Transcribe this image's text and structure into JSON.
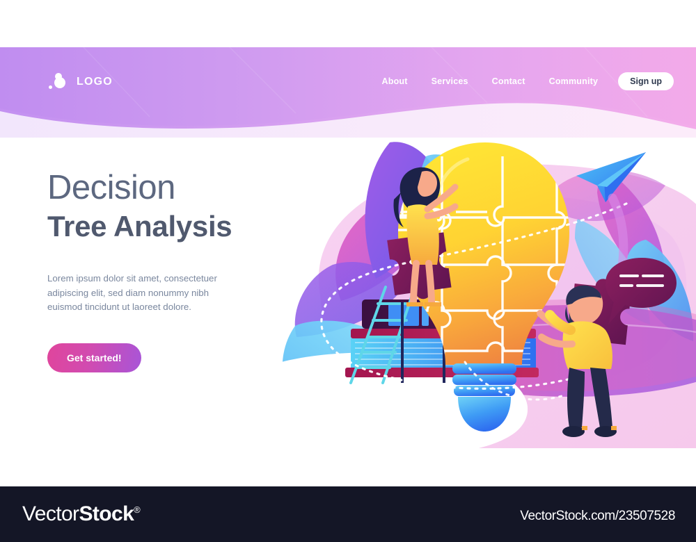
{
  "page": {
    "title": "Decision Tree Analysis landing page"
  },
  "header": {
    "logo": {
      "text": "LOGO",
      "mark_icon": "logo-dots-icon"
    },
    "nav_items": [
      {
        "label": "About"
      },
      {
        "label": "Services"
      },
      {
        "label": "Contact"
      },
      {
        "label": "Community"
      }
    ],
    "signup_label": "Sign up",
    "gradient_from": "#c08df0",
    "gradient_to": "#f0a8e8"
  },
  "hero": {
    "heading_light": "Decision",
    "heading_bold": "Tree Analysis",
    "paragraph": "Lorem ipsum dolor sit amet, consectetuer adipiscing elit, sed diam nonummy nibh euismod tincidunt ut laoreet dolore.",
    "cta_label": "Get started!",
    "heading_color": "#5d6880",
    "paragraph_color": "#7a879e",
    "cta_gradient_from": "#e0459c",
    "cta_gradient_to": "#a855d8"
  },
  "illustration": {
    "name": "decision-tree-analysis-illustration",
    "elements": [
      "lightbulb-puzzle",
      "woman-on-ladder",
      "man-with-speech-bubble",
      "stacked-books",
      "paper-plane",
      "loose-puzzle-pieces",
      "leaf-shapes",
      "dotted-path"
    ],
    "colors": {
      "bulb_top": "#ffe234",
      "bulb_bottom": "#f5933d",
      "bulb_base": "#3d8bf5",
      "puzzle_loose": "#7a1f5c",
      "shirt_yellow": "#ffd24a",
      "pants_navy": "#242a4a",
      "leaf_violet": "#9b5de5",
      "leaf_blue": "#4cc9f0",
      "leaf_pink": "#e055b8",
      "backdrop_pink": "#f6cfee"
    }
  },
  "footer": {
    "brand_part1": "Vector",
    "brand_part2": "Stock",
    "brand_reg": "®",
    "url": "VectorStock.com/23507528",
    "background": "#141626"
  }
}
